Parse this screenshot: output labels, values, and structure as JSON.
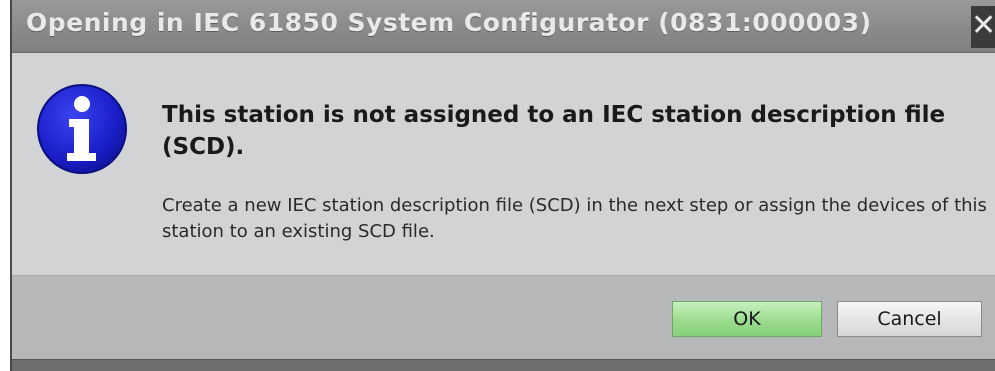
{
  "dialog": {
    "title": "Opening in IEC 61850 System Configurator (0831:000003)",
    "close_glyph": "✕",
    "icon": "info-icon",
    "heading": "This station is not assigned to an IEC station description file (SCD).",
    "message": "Create a new IEC station description file (SCD) in the next step or assign the devices of this station to an existing SCD file.",
    "buttons": {
      "ok_label": "OK",
      "cancel_label": "Cancel"
    }
  },
  "colors": {
    "info_blue": "#1a1ec8",
    "ok_green": "#9fdd92",
    "titlebar": "#8c8d8e"
  }
}
